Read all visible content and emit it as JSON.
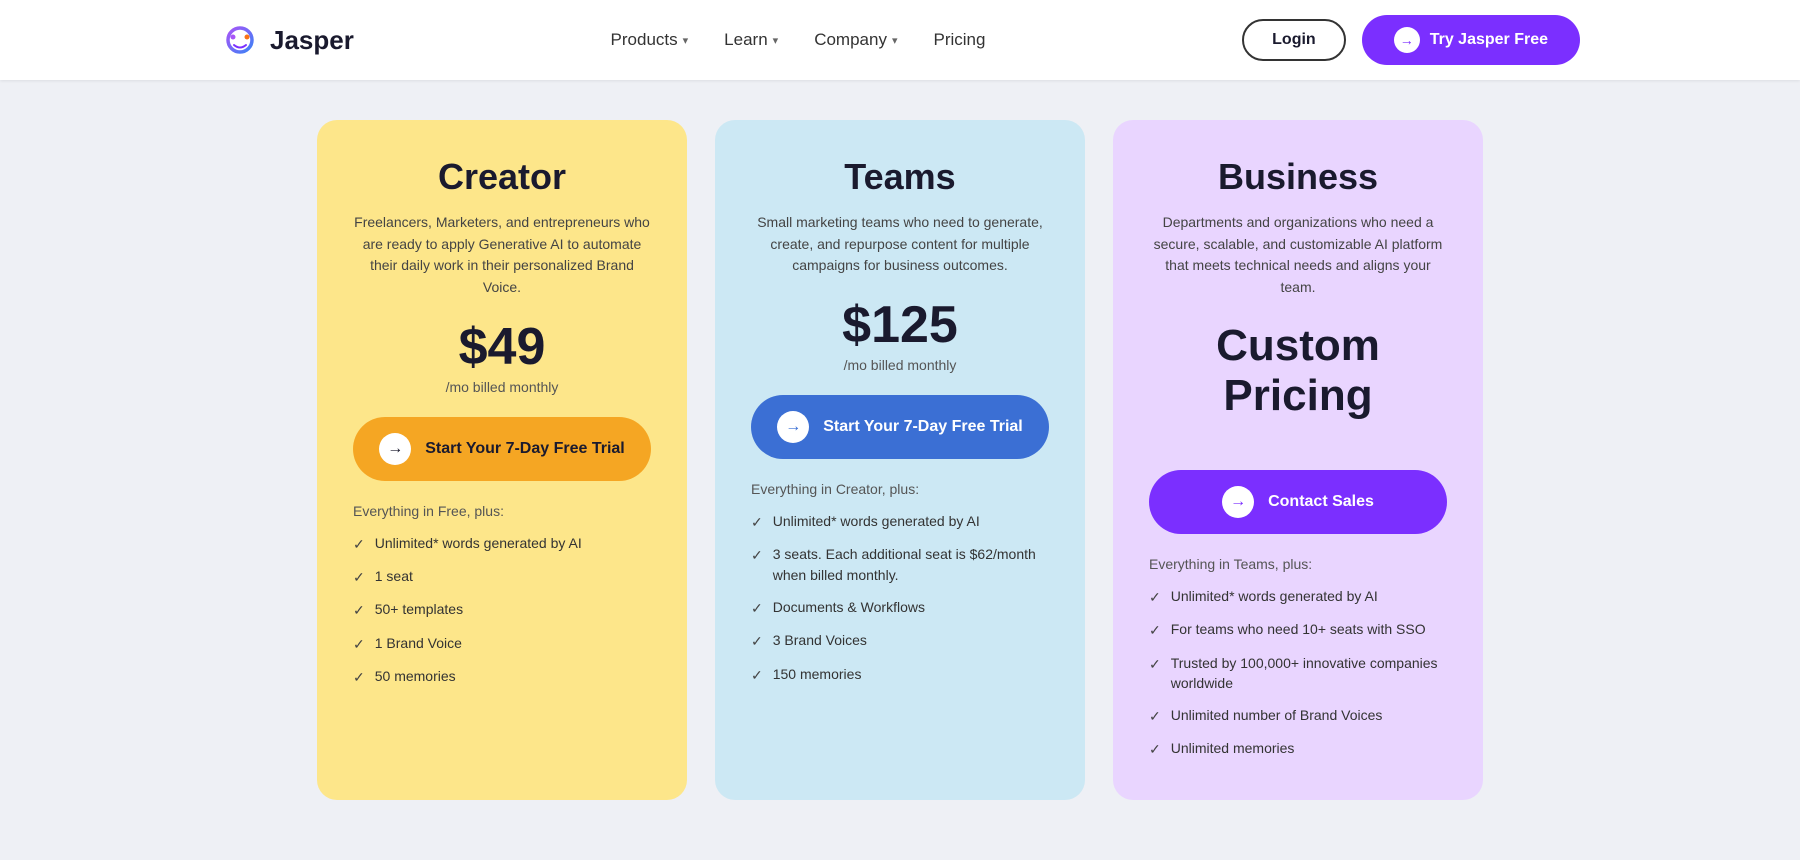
{
  "nav": {
    "logo_text": "Jasper",
    "links": [
      {
        "label": "Products",
        "has_dropdown": true
      },
      {
        "label": "Learn",
        "has_dropdown": true
      },
      {
        "label": "Company",
        "has_dropdown": true
      },
      {
        "label": "Pricing",
        "has_dropdown": false
      }
    ],
    "login_label": "Login",
    "try_label": "Try Jasper Free"
  },
  "pricing": {
    "cards": [
      {
        "id": "creator",
        "title": "Creator",
        "description": "Freelancers, Marketers, and entrepreneurs who are ready to apply Generative AI to automate their daily work in their personalized Brand Voice.",
        "price": "$49",
        "price_sub": "/mo billed monthly",
        "cta_label": "Start Your 7-Day Free Trial",
        "features_intro": "Everything in Free, plus:",
        "features": [
          "Unlimited* words generated by AI",
          "1 seat",
          "50+ templates",
          "1 Brand Voice",
          "50 memories"
        ]
      },
      {
        "id": "teams",
        "title": "Teams",
        "description": "Small marketing teams who need to generate, create, and repurpose content for multiple campaigns for business outcomes.",
        "price": "$125",
        "price_sub": "/mo billed monthly",
        "cta_label": "Start Your 7-Day Free Trial",
        "features_intro": "Everything in Creator, plus:",
        "features": [
          "Unlimited* words generated by AI",
          "3 seats. Each additional seat is $62/month when billed monthly.",
          "Documents & Workflows",
          "3 Brand Voices",
          "150 memories"
        ]
      },
      {
        "id": "business",
        "title": "Business",
        "description": "Departments and organizations who need a secure, scalable, and customizable AI platform that meets technical needs and aligns your team.",
        "price": "Custom\nPricing",
        "price_sub": "",
        "cta_label": "Contact Sales",
        "features_intro": "Everything in Teams, plus:",
        "features": [
          "Unlimited* words generated by AI",
          "For teams who need 10+ seats with SSO",
          "Trusted by 100,000+ innovative companies worldwide",
          "Unlimited number of Brand Voices",
          "Unlimited memories"
        ]
      }
    ]
  }
}
